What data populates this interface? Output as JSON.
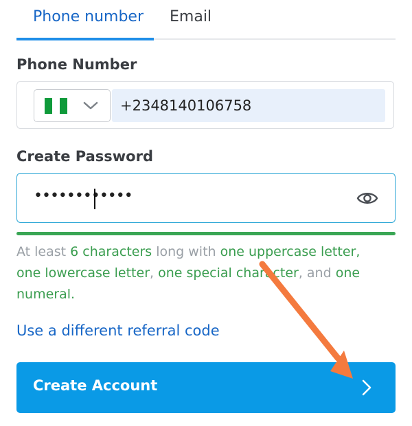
{
  "tabs": {
    "phone": "Phone number",
    "email": "Email",
    "active": "phone"
  },
  "phone": {
    "label": "Phone Number",
    "country_flag": "nigeria-flag-icon",
    "value": "+2348140106758"
  },
  "password": {
    "label": "Create Password",
    "masked_value": "••••••••••••",
    "visibility_icon": "eye-icon",
    "strength_color": "#3aa655"
  },
  "hint": {
    "part1": "At least ",
    "req1": "6 characters",
    "part2": " long with ",
    "req2": "one uppercase letter",
    "part3": ",",
    "req3": "one lowercase letter",
    "part4": ", ",
    "req4": "one special character",
    "part5": ", and ",
    "req5": "one numeral",
    "part6": "."
  },
  "referral_link": "Use a different referral code",
  "create_button": {
    "label": "Create Account",
    "icon": "chevron-right-icon",
    "color": "#0a9ae6"
  },
  "annotation": {
    "type": "arrow",
    "color": "#f47a3e"
  }
}
